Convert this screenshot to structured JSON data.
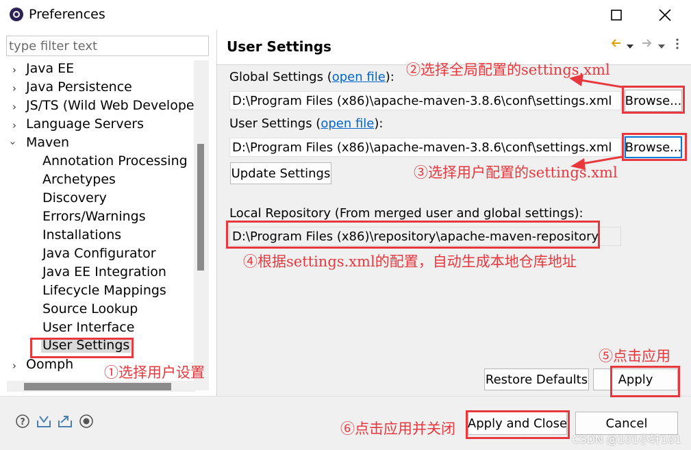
{
  "window": {
    "title": "Preferences"
  },
  "filter": {
    "placeholder": "type filter text"
  },
  "tree": {
    "items": [
      {
        "label": "Java EE",
        "expanded": false
      },
      {
        "label": "Java Persistence",
        "expanded": false
      },
      {
        "label": "JS/TS (Wild Web Developer)",
        "expanded": false
      },
      {
        "label": "Language Servers",
        "expanded": false
      },
      {
        "label": "Maven",
        "expanded": true
      },
      {
        "label": "Annotation Processing"
      },
      {
        "label": "Archetypes"
      },
      {
        "label": "Discovery"
      },
      {
        "label": "Errors/Warnings"
      },
      {
        "label": "Installations"
      },
      {
        "label": "Java Configurator"
      },
      {
        "label": "Java EE Integration"
      },
      {
        "label": "Lifecycle Mappings"
      },
      {
        "label": "Source Lookup"
      },
      {
        "label": "User Interface"
      },
      {
        "label": "User Settings",
        "selected": true
      },
      {
        "label": "Oomph",
        "expanded": false
      }
    ]
  },
  "page": {
    "title": "User Settings",
    "global": {
      "label_pre": "Global Settings (",
      "link": "open file",
      "label_post": "):",
      "value": "D:\\Program Files (x86)\\apache-maven-3.8.6\\conf\\settings.xml",
      "browse": "Browse..."
    },
    "user": {
      "label_pre": "User Settings (",
      "link": "open file",
      "label_post": "):",
      "value": "D:\\Program Files (x86)\\apache-maven-3.8.6\\conf\\settings.xml",
      "browse": "Browse..."
    },
    "update_settings": "Update Settings",
    "local_repo": {
      "label": "Local Repository (From merged user and global settings):",
      "value": "D:\\Program Files (x86)\\repository\\apache-maven-repository"
    },
    "restore_defaults": "Restore Defaults",
    "apply": "Apply"
  },
  "footer": {
    "apply_and_close": "Apply and Close",
    "cancel": "Cancel"
  },
  "annotations": {
    "a1": "①选择用户设置",
    "a2": "②选择全局配置的settings.xml",
    "a3": "③选择用户配置的settings.xml",
    "a4": "④根据settings.xml的配置，自动生成本地仓库地址",
    "a5": "⑤点击应用",
    "a6": "⑥点击应用并关闭"
  },
  "watermark": "CSDN @101小轩101",
  "colors": {
    "annotation": "#e8383d",
    "link": "#0066cc",
    "panel": "#f0f0f0"
  }
}
